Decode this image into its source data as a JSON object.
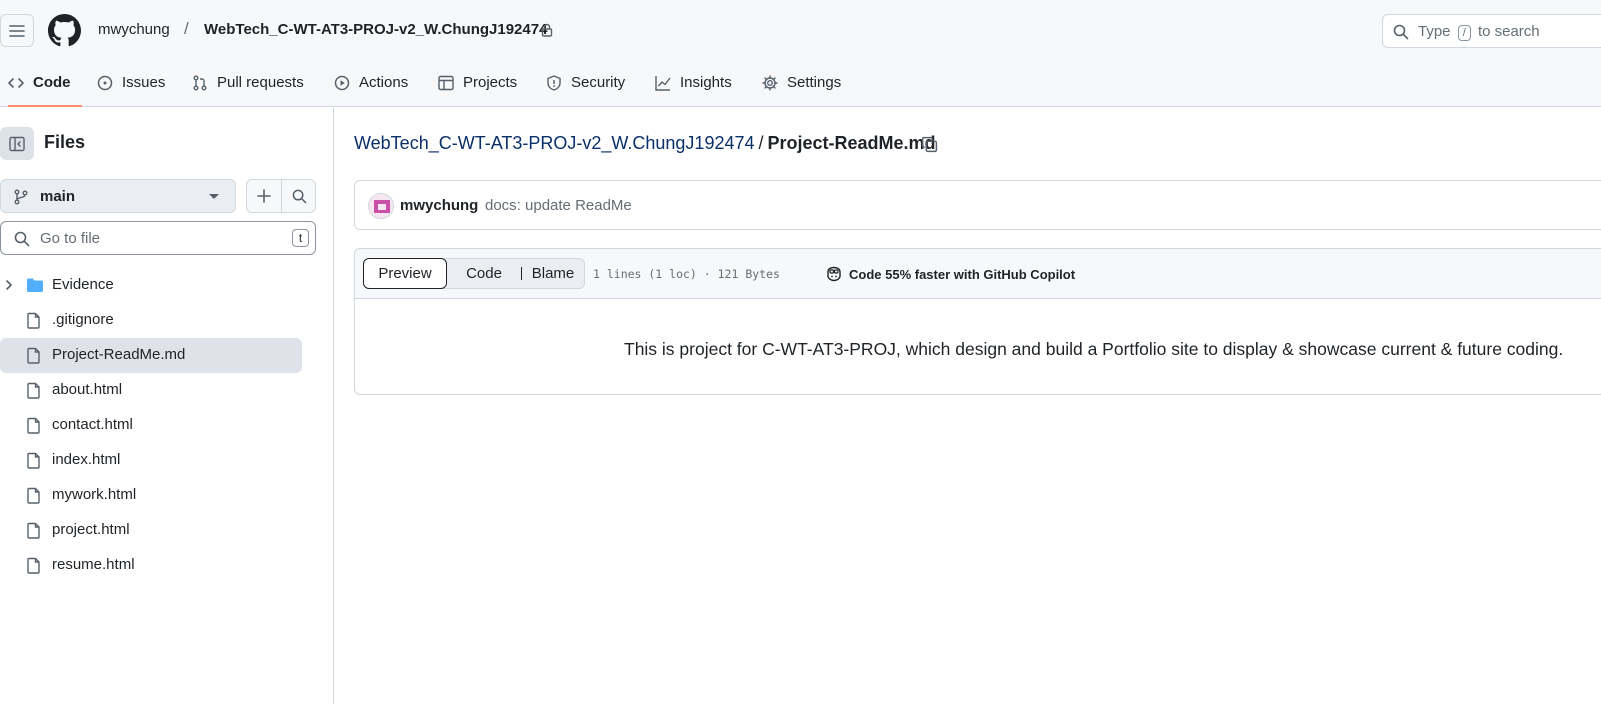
{
  "header": {
    "owner": "mwychung",
    "slash": "/",
    "repo": "WebTech_C-WT-AT3-PROJ-v2_W.ChungJ192474",
    "search": {
      "prefix": "Type",
      "key": "/",
      "suffix": "to search"
    }
  },
  "tabs": [
    {
      "label": "Code",
      "icon": "code-icon"
    },
    {
      "label": "Issues",
      "icon": "issue-icon"
    },
    {
      "label": "Pull requests",
      "icon": "pull-request-icon"
    },
    {
      "label": "Actions",
      "icon": "play-icon"
    },
    {
      "label": "Projects",
      "icon": "table-icon"
    },
    {
      "label": "Security",
      "icon": "shield-icon"
    },
    {
      "label": "Insights",
      "icon": "graph-icon"
    },
    {
      "label": "Settings",
      "icon": "gear-icon"
    }
  ],
  "sidebar": {
    "title": "Files",
    "branch": "main",
    "goto_placeholder": "Go to file",
    "goto_key": "t",
    "items": [
      {
        "name": "Evidence",
        "type": "folder"
      },
      {
        "name": ".gitignore",
        "type": "file"
      },
      {
        "name": "Project-ReadMe.md",
        "type": "file"
      },
      {
        "name": "about.html",
        "type": "file"
      },
      {
        "name": "contact.html",
        "type": "file"
      },
      {
        "name": "index.html",
        "type": "file"
      },
      {
        "name": "mywork.html",
        "type": "file"
      },
      {
        "name": "project.html",
        "type": "file"
      },
      {
        "name": "resume.html",
        "type": "file"
      }
    ]
  },
  "breadcrumb": {
    "repo": "WebTech_C-WT-AT3-PROJ-v2_W.ChungJ192474",
    "separator": "/",
    "file": "Project-ReadMe.md"
  },
  "commit": {
    "author": "mwychung",
    "message": "docs: update ReadMe"
  },
  "file_view": {
    "tabs": [
      "Preview",
      "Code",
      "Blame"
    ],
    "info": "1 lines (1 loc) · 121 Bytes",
    "copilot": "Code 55% faster with GitHub Copilot",
    "content": "This is project for C-WT-AT3-PROJ, which design and build a Portfolio site to display & showcase current & future coding."
  },
  "colors": {
    "accent_underline": "#fd8c73",
    "link": "#0a3069",
    "folder": "#54aeff",
    "header_bg": "#f6f8fa",
    "selected_bg": "#dfe3e9"
  }
}
